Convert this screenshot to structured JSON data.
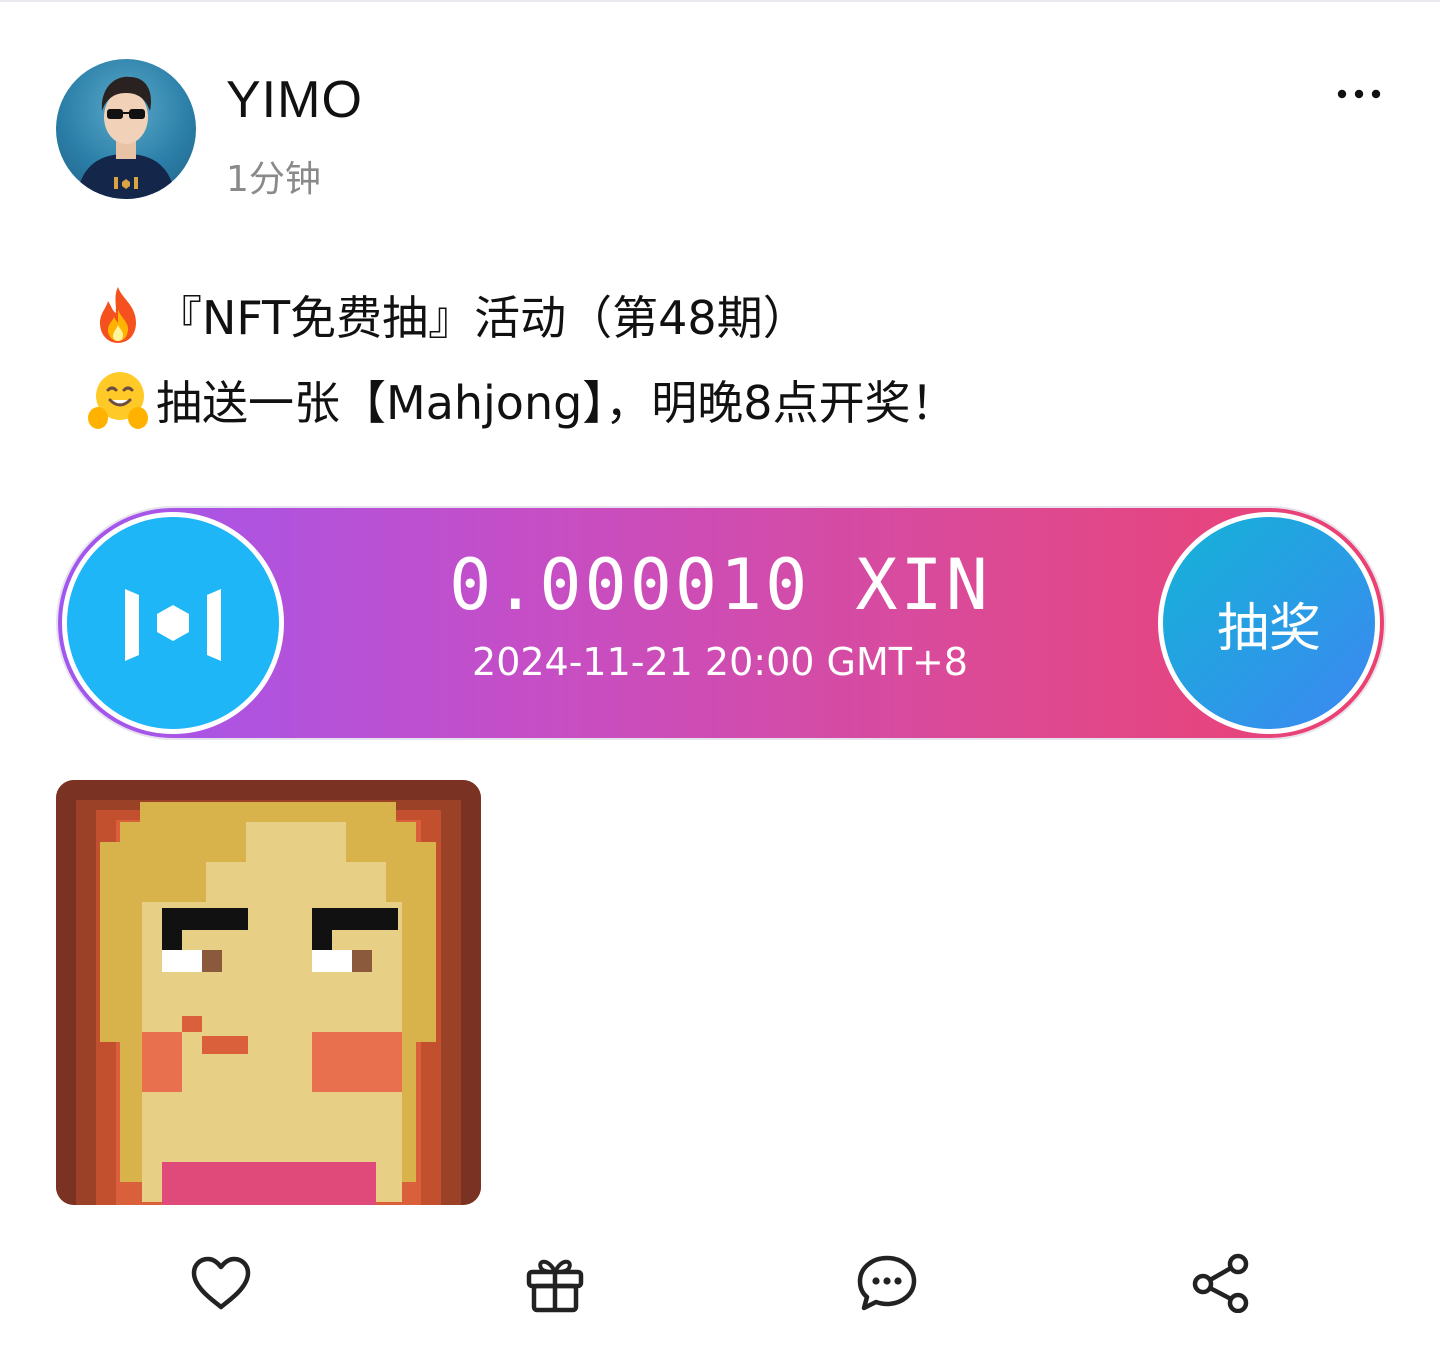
{
  "post": {
    "author": "YIMO",
    "time": "1分钟",
    "line1": "『NFT免费抽』活动（第48期）",
    "line2": "抽送一张【Mahjong】，明晚8点开奖！",
    "line1_emoji": "fire-emoji",
    "line2_emoji": "hugging-face-emoji"
  },
  "lottery": {
    "amount": "0.000010 XIN",
    "datetime": "2024-11-21 20:00 GMT+8",
    "button_label": "抽奖",
    "logo_icon": "mixin-logo-icon",
    "colors": {
      "gradient_start": "#a057f0",
      "gradient_end": "#ec4170",
      "logo_bg": "#1fb6f7",
      "button_start": "#14b3d6",
      "button_end": "#3e86f2"
    }
  },
  "actions": [
    {
      "name": "like",
      "icon": "heart-icon"
    },
    {
      "name": "gift",
      "icon": "gift-icon"
    },
    {
      "name": "comment",
      "icon": "comment-icon"
    },
    {
      "name": "share",
      "icon": "share-icon"
    }
  ],
  "menu_icon": "more-dots-icon"
}
